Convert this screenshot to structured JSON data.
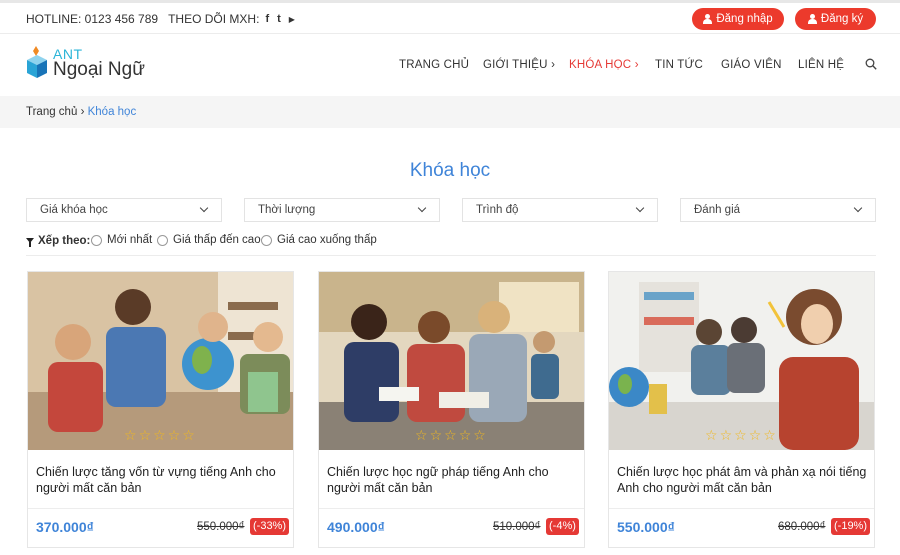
{
  "topbar": {
    "hotline": "HOTLINE: 0123 456 789",
    "follow": "THEO DÕI MXH:",
    "social_icons": [
      "facebook-icon",
      "twitter-icon",
      "youtube-icon"
    ],
    "social_glyphs": [
      "f",
      "t",
      "▶"
    ],
    "login_label": "Đăng nhập",
    "register_label": "Đăng ký"
  },
  "logo": {
    "small": "ANT",
    "big": "Ngoại Ngữ"
  },
  "nav": {
    "items": [
      {
        "label": "TRANG CHỦ"
      },
      {
        "label": "GIỚI THIỆU ›"
      },
      {
        "label": "KHÓA HỌC ›"
      },
      {
        "label": "TIN TỨC"
      },
      {
        "label": "GIÁO VIÊN"
      },
      {
        "label": "LIÊN HỆ"
      }
    ],
    "active_index": 2
  },
  "breadcrumb": {
    "home": "Trang chủ",
    "separator": "›",
    "current": "Khóa học"
  },
  "page_title": "Khóa học",
  "filters": [
    {
      "label": "Giá khóa học"
    },
    {
      "label": "Thời lượng"
    },
    {
      "label": "Trình độ"
    },
    {
      "label": "Đánh giá"
    }
  ],
  "sort": {
    "title": "Xếp theo:",
    "options": [
      "Mới nhất",
      "Giá thấp đến cao",
      "Giá cao xuống thấp"
    ]
  },
  "courses": [
    {
      "title": "Chiến lược tăng vốn từ vựng tiếng Anh cho người mất căn bản",
      "price": "370.000₫",
      "old_price": "550.000₫",
      "discount": "(-33%)",
      "rating": 0
    },
    {
      "title": "Chiến lược học ngữ pháp tiếng Anh cho người mất căn bản",
      "price": "490.000₫",
      "old_price": "510.000₫",
      "discount": "(-4%)",
      "rating": 0
    },
    {
      "title": "Chiến lược học phát âm và phản xạ nói tiếng Anh cho người mất căn bản",
      "price": "550.000₫",
      "old_price": "680.000₫",
      "discount": "(-19%)",
      "rating": 0
    }
  ],
  "colors": {
    "accent": "#3f84d8",
    "brand_red": "#ec3a2c",
    "star": "#f1b81f"
  }
}
